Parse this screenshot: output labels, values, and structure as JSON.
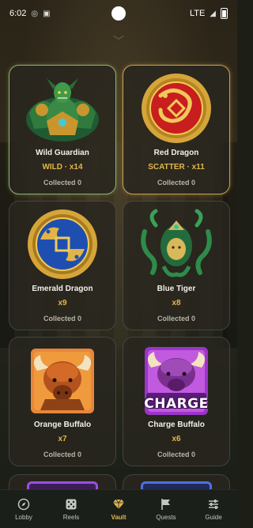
{
  "status": {
    "time": "6:02",
    "network": "LTE"
  },
  "cards": [
    {
      "name": "Wild Guardian",
      "tag": "WILD · x14",
      "collected": "Collected 0",
      "icon": "green-guardian-icon"
    },
    {
      "name": "Red Dragon",
      "tag": "SCATTER · x11",
      "collected": "Collected 0",
      "icon": "red-dragon-coin-icon"
    },
    {
      "name": "Emerald Dragon",
      "tag": "x9",
      "collected": "Collected 0",
      "icon": "blue-dragon-coin-icon"
    },
    {
      "name": "Blue Tiger",
      "tag": "x8",
      "collected": "Collected 0",
      "icon": "serpent-idol-icon"
    },
    {
      "name": "Orange Buffalo",
      "tag": "x7",
      "collected": "Collected 0",
      "icon": "orange-buffalo-icon"
    },
    {
      "name": "Charge Buffalo",
      "tag": "x6",
      "collected": "Collected 0",
      "icon": "charge-buffalo-icon",
      "badge": "CHARGE"
    }
  ],
  "tabs": [
    {
      "label": "Lobby",
      "icon": "compass-icon"
    },
    {
      "label": "Reels",
      "icon": "dice-icon"
    },
    {
      "label": "Vault",
      "icon": "gem-icon",
      "active": true
    },
    {
      "label": "Quests",
      "icon": "flag-icon"
    },
    {
      "label": "Guide",
      "icon": "sliders-icon"
    }
  ],
  "colors": {
    "accent": "#e6b44a",
    "tag": "#e2b64a"
  }
}
